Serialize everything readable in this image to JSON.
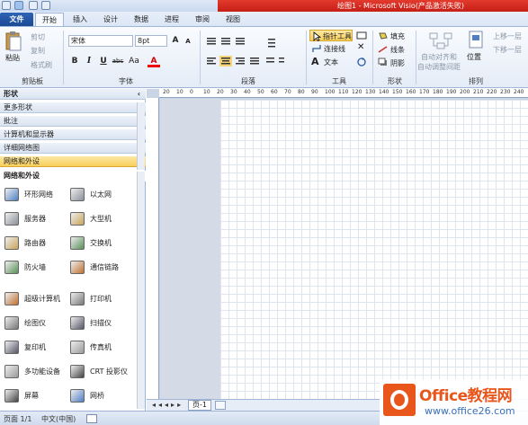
{
  "window": {
    "title": "绘图1 - Microsoft Visio(产品激活失败)"
  },
  "tabs": [
    {
      "label": "文件"
    },
    {
      "label": "开始"
    },
    {
      "label": "插入"
    },
    {
      "label": "设计"
    },
    {
      "label": "数据"
    },
    {
      "label": "进程"
    },
    {
      "label": "审阅"
    },
    {
      "label": "视图"
    }
  ],
  "ribbon": {
    "clipboard": {
      "paste": "粘贴",
      "cut": "剪切",
      "copy": "复制",
      "format_painter": "格式刷",
      "label": "剪贴板"
    },
    "font": {
      "family": "宋体",
      "size": "8pt",
      "grow": "A",
      "shrink": "A",
      "bold": "B",
      "italic": "I",
      "underline": "U",
      "strike": "abc",
      "case": "Aa",
      "color": "A",
      "label": "字体"
    },
    "paragraph": {
      "label": "段落"
    },
    "tools": {
      "pointer": "指针工具",
      "connector": "连接线",
      "text": "文本",
      "text_icon": "A",
      "label": "工具"
    },
    "shape": {
      "fill": "填充",
      "line": "线条",
      "shadow": "阴影",
      "label": "形状"
    },
    "arrange": {
      "auto_align": "自动对齐和",
      "auto_space": "自动调整间距",
      "position": "位置",
      "bring_forward": "上移一层",
      "send_backward": "下移一层",
      "label": "排列"
    }
  },
  "pane": {
    "title": "形状",
    "sections": [
      {
        "label": "更多形状"
      },
      {
        "label": "批注"
      },
      {
        "label": "计算机和显示器"
      },
      {
        "label": "详细网络图"
      },
      {
        "label": "网络和外设"
      }
    ],
    "stencil_title": "网络和外设",
    "shapes": [
      [
        "环形网络",
        "以太网"
      ],
      [
        "服务器",
        "大型机"
      ],
      [
        "路由器",
        "交换机"
      ],
      [
        "防火墙",
        "通信链路"
      ],
      [
        "超级计算机",
        "打印机"
      ],
      [
        "绘图仪",
        "扫描仪"
      ],
      [
        "复印机",
        "传真机"
      ],
      [
        "多功能设备",
        "CRT 投影仪"
      ],
      [
        "屏幕",
        "网桥"
      ]
    ]
  },
  "ruler": {
    "h": [
      "20",
      "10",
      "0",
      "10",
      "20",
      "30",
      "40",
      "50",
      "60",
      "70",
      "80",
      "90",
      "100",
      "110",
      "120",
      "130",
      "140",
      "150",
      "160",
      "170",
      "180",
      "190",
      "200",
      "210",
      "220",
      "230",
      "240"
    ]
  },
  "page_tabs": {
    "tab1": "页-1"
  },
  "status": {
    "page": "页面 1/1",
    "lang": "中文(中国)"
  },
  "watermark": {
    "brand": "Office教程网",
    "url": "www.office26.com"
  },
  "colors": {
    "file_tab": "#1c4a95",
    "title_red": "#c51f16",
    "selected": "#f8cf5a",
    "accent": "#e8561c"
  }
}
